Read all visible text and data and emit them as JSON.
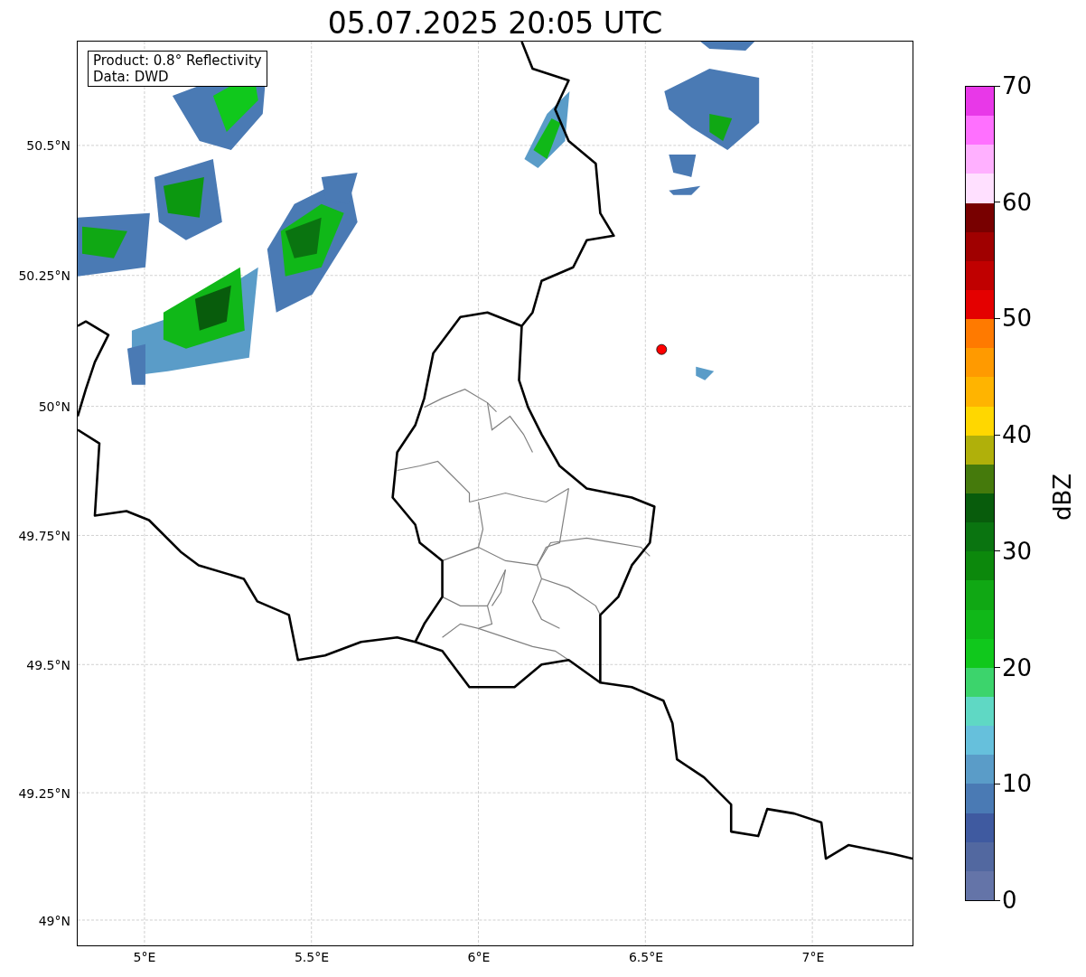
{
  "title": "05.07.2025 20:05 UTC",
  "info_box": [
    "Product: 0.8° Reflectivity",
    "Data: DWD"
  ],
  "map": {
    "marker": {
      "color": "#ff0000"
    }
  },
  "x_ticks": [
    "5°E",
    "5.5°E",
    "6°E",
    "6.5°E",
    "7°E"
  ],
  "y_ticks": [
    "50.5°N",
    "50.25°N",
    "50°N",
    "49.75°N",
    "49.5°N",
    "49.25°N",
    "49°N"
  ],
  "colorbar": {
    "label": "dBZ",
    "ticks": [
      "70",
      "60",
      "50",
      "40",
      "30",
      "20",
      "10",
      "0"
    ],
    "bins": [
      {
        "color": "#e838e8"
      },
      {
        "color": "#ff70ff"
      },
      {
        "color": "#ffb0ff"
      },
      {
        "color": "#ffe0ff"
      },
      {
        "color": "#780000"
      },
      {
        "color": "#a00000"
      },
      {
        "color": "#c00000"
      },
      {
        "color": "#e40000"
      },
      {
        "color": "#ff7a00"
      },
      {
        "color": "#ff9a00"
      },
      {
        "color": "#ffb400"
      },
      {
        "color": "#ffd700"
      },
      {
        "color": "#b0b00a"
      },
      {
        "color": "#457a0c"
      },
      {
        "color": "#085c0c"
      },
      {
        "color": "#0a7410"
      },
      {
        "color": "#0c880c"
      },
      {
        "color": "#10a814"
      },
      {
        "color": "#10b818"
      },
      {
        "color": "#10c81c"
      },
      {
        "color": "#3cd46c"
      },
      {
        "color": "#5fd8c4"
      },
      {
        "color": "#66c0dc"
      },
      {
        "color": "#5a9cc8"
      },
      {
        "color": "#4a7ab4"
      },
      {
        "color": "#3f5aa0"
      },
      {
        "color": "#5268a0"
      },
      {
        "color": "#6474a8"
      }
    ]
  }
}
